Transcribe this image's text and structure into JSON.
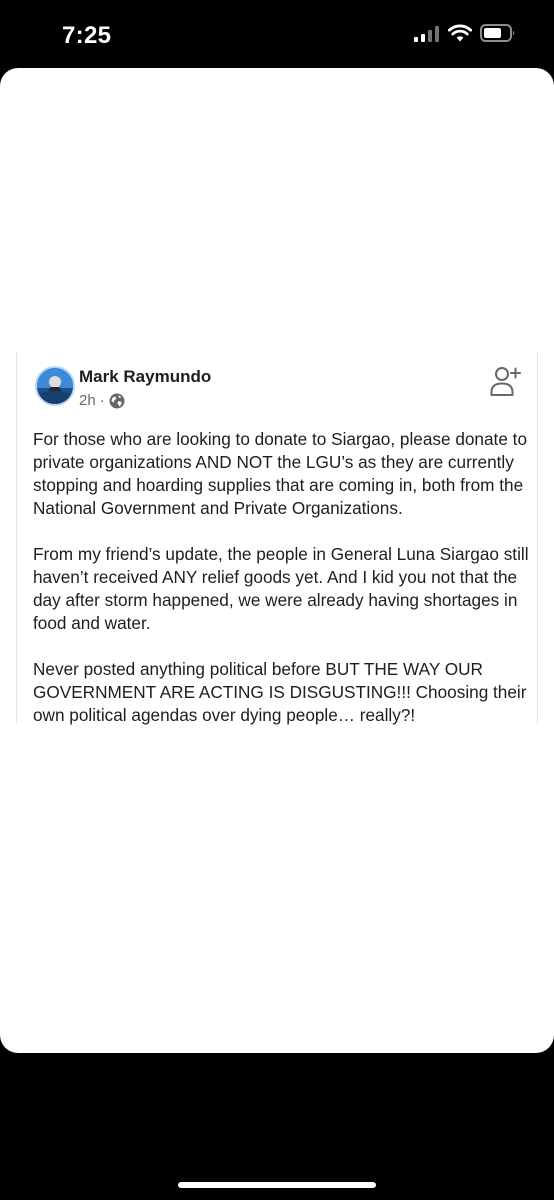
{
  "status_bar": {
    "time": "7:25",
    "icons": [
      "signal-icon",
      "wifi-icon",
      "battery-icon"
    ]
  },
  "post": {
    "author": "Mark Raymundo",
    "time": "2h",
    "separator": "·",
    "privacy_icon": "globe-icon",
    "action_icon": "add-friend-icon",
    "paragraphs": [
      "For those who are looking to donate to Siargao, please donate to private organizations AND NOT the LGU’s as they are currently stopping and hoarding supplies that are coming in, both from the National Government and Private Organizations.",
      "From my friend’s update, the people in General Luna Siargao still haven’t received ANY relief goods yet. And I kid you not that the day after storm happened, we were already having shortages in food and water.",
      "Never posted anything political before BUT THE WAY OUR GOVERNMENT ARE ACTING IS DISGUSTING!!! Choosing their own political agendas over dying people… really?!"
    ]
  },
  "colors": {
    "text": "#1c1e21",
    "meta": "#65676b",
    "background": "#000000",
    "sheet": "#ffffff"
  }
}
